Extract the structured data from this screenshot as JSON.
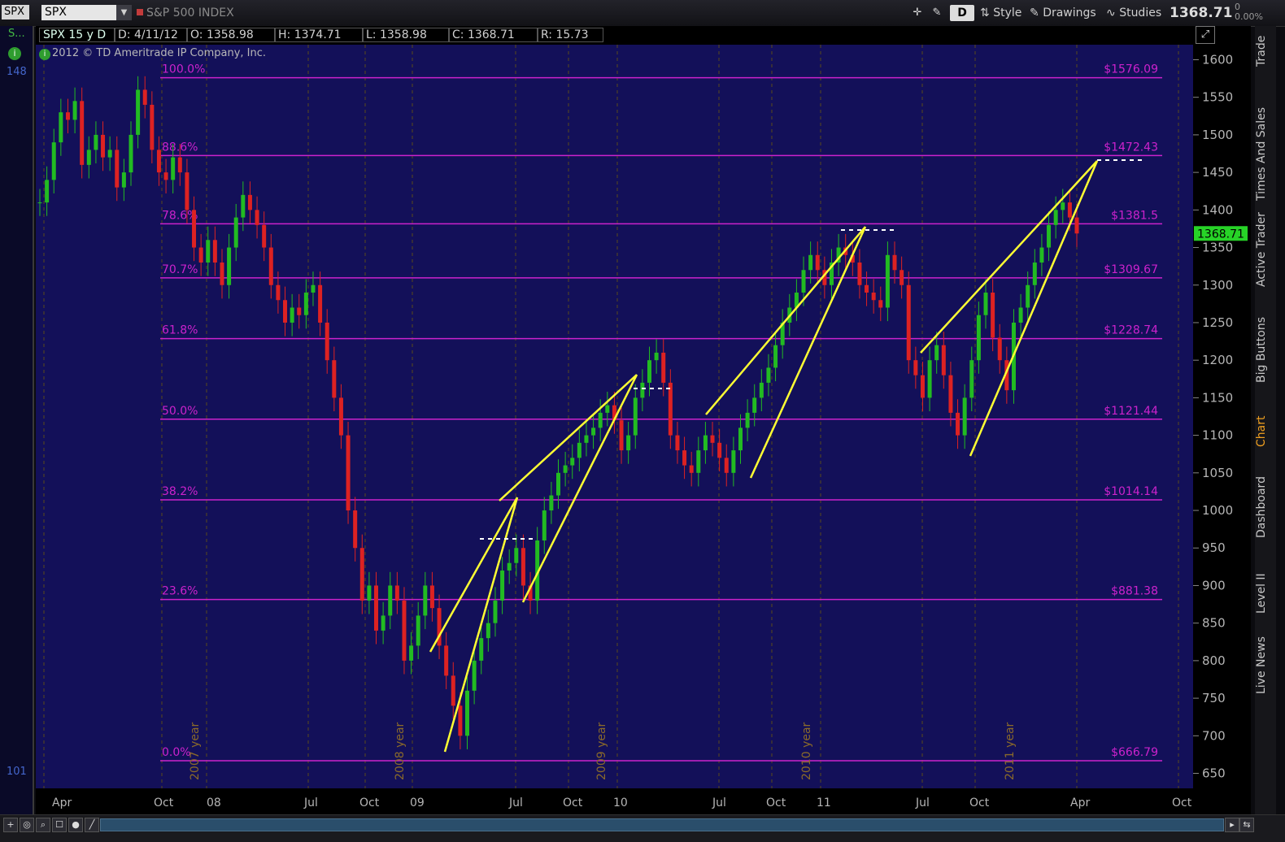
{
  "topbar": {
    "symbol_short": "SPX",
    "symbol_input": "SPX",
    "title": "S&P 500 INDEX",
    "d_button": "D",
    "style_label": "Style",
    "drawings_label": "Drawings",
    "studies_label": "Studies",
    "last_price": "1368.71",
    "change": "0",
    "change_pct": "0.00%"
  },
  "leftstrip": {
    "label_top": "S...",
    "num_top": "148",
    "num_bottom": "101"
  },
  "header": {
    "period": "SPX 15 y D",
    "date": "D: 4/11/12",
    "open": "O: 1358.98",
    "high": "H: 1374.71",
    "low": "L: 1358.98",
    "close": "C: 1368.71",
    "range": "R: 15.73",
    "copyright": "2012 © TD Ameritrade IP Company, Inc."
  },
  "side_tabs": [
    "Trade",
    "Times And Sales",
    "Active Trader",
    "Big Buttons",
    "Chart",
    "Dashboard",
    "Level II",
    "Live News"
  ],
  "active_tab": "Chart",
  "colors": {
    "plot_bg": "#131059",
    "fib": "#cc22cc",
    "trend": "#ffff33",
    "up": "#22bb22",
    "down": "#dd2222"
  },
  "chart_data": {
    "type": "candlestick",
    "title": "S&P 500 INDEX",
    "ylim": [
      630,
      1620
    ],
    "y_ticks": [
      650,
      700,
      750,
      800,
      850,
      900,
      950,
      1000,
      1050,
      1100,
      1150,
      1200,
      1250,
      1300,
      1350,
      1400,
      1450,
      1500,
      1550,
      1600
    ],
    "x_labels": [
      "Apr",
      "Oct",
      "08",
      "Jul",
      "Oct",
      "09",
      "Jul",
      "Oct",
      "10",
      "Jul",
      "Oct",
      "11",
      "Jul",
      "Oct",
      "Apr",
      "Oct"
    ],
    "year_labels": [
      "2007 year",
      "2008 year",
      "2009 year",
      "2010 year",
      "2011 year"
    ],
    "current_price_label": "1368.71",
    "close_series": [
      1410,
      1440,
      1490,
      1530,
      1520,
      1545,
      1460,
      1480,
      1500,
      1470,
      1480,
      1430,
      1450,
      1500,
      1560,
      1540,
      1480,
      1450,
      1440,
      1470,
      1450,
      1400,
      1350,
      1330,
      1360,
      1330,
      1300,
      1350,
      1390,
      1420,
      1400,
      1380,
      1350,
      1300,
      1280,
      1250,
      1270,
      1260,
      1290,
      1300,
      1250,
      1200,
      1150,
      1100,
      1000,
      950,
      880,
      900,
      840,
      860,
      900,
      880,
      800,
      820,
      860,
      900,
      870,
      820,
      780,
      740,
      700,
      760,
      800,
      830,
      850,
      880,
      920,
      930,
      950,
      900,
      880,
      960,
      1000,
      1020,
      1050,
      1060,
      1070,
      1090,
      1100,
      1110,
      1130,
      1140,
      1120,
      1080,
      1100,
      1150,
      1170,
      1200,
      1210,
      1170,
      1100,
      1080,
      1060,
      1050,
      1080,
      1100,
      1090,
      1070,
      1050,
      1080,
      1110,
      1130,
      1150,
      1170,
      1190,
      1220,
      1250,
      1270,
      1290,
      1320,
      1340,
      1320,
      1300,
      1330,
      1350,
      1340,
      1330,
      1300,
      1290,
      1280,
      1270,
      1340,
      1320,
      1300,
      1200,
      1180,
      1150,
      1200,
      1220,
      1180,
      1130,
      1100,
      1150,
      1200,
      1260,
      1290,
      1230,
      1200,
      1160,
      1250,
      1270,
      1300,
      1330,
      1350,
      1380,
      1400,
      1410,
      1390,
      1368.71
    ],
    "fib_levels": [
      {
        "pct": "100.0%",
        "price_label": "$1576.09",
        "value": 1576.09
      },
      {
        "pct": "88.6%",
        "price_label": "$1472.43",
        "value": 1472.43
      },
      {
        "pct": "78.6%",
        "price_label": "$1381.5",
        "value": 1381.5
      },
      {
        "pct": "70.7%",
        "price_label": "$1309.67",
        "value": 1309.67
      },
      {
        "pct": "61.8%",
        "price_label": "$1228.74",
        "value": 1228.74
      },
      {
        "pct": "50.0%",
        "price_label": "$1121.44",
        "value": 1121.44
      },
      {
        "pct": "38.2%",
        "price_label": "$1014.14",
        "value": 1014.14
      },
      {
        "pct": "23.6%",
        "price_label": "$881.38",
        "value": 881.38
      },
      {
        "pct": "0.0%",
        "price_label": "$666.79",
        "value": 666.79
      }
    ]
  }
}
